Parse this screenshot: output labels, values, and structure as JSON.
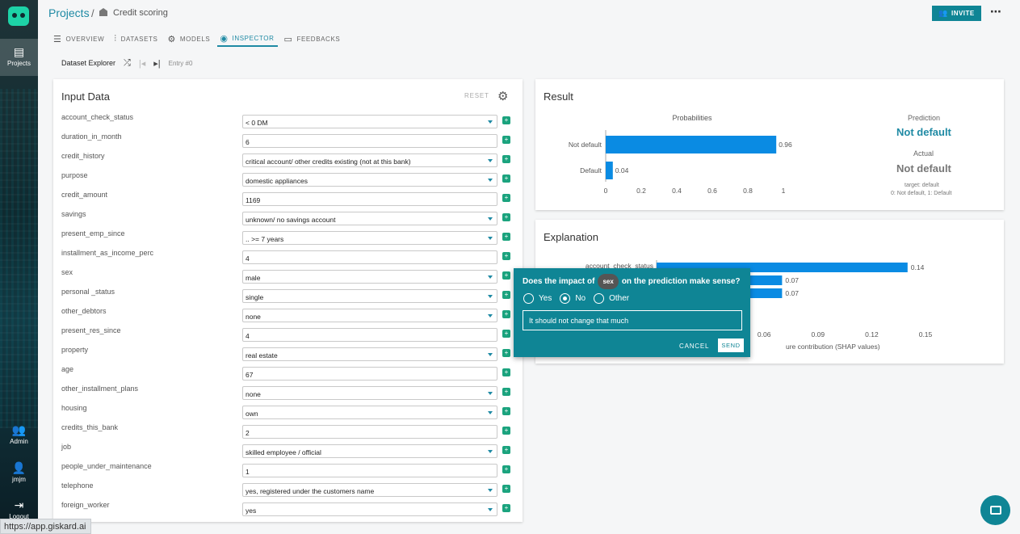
{
  "sidebar": {
    "projects_label": "Projects",
    "admin_label": "Admin",
    "user_label": "jmjm",
    "logout_label": "Logout"
  },
  "header": {
    "breadcrumb_root": "Projects",
    "breadcrumb_sep": "/",
    "breadcrumb_current": "Credit scoring",
    "invite_label": "INVITE",
    "more_label": "⋯"
  },
  "tabs": [
    {
      "label": "OVERVIEW",
      "icon": "list-icon",
      "active": false
    },
    {
      "label": "DATASETS",
      "icon": "bar-chart-icon",
      "active": false
    },
    {
      "label": "MODELS",
      "icon": "cog-icon",
      "active": false
    },
    {
      "label": "INSPECTOR",
      "icon": "inspector-icon",
      "active": true
    },
    {
      "label": "FEEDBACKS",
      "icon": "comment-icon",
      "active": false
    }
  ],
  "explorer": {
    "title": "Dataset Explorer",
    "entry_label": "Entry #0"
  },
  "input_data": {
    "title": "Input Data",
    "reset_label": "RESET",
    "fields": [
      {
        "label": "account_check_status",
        "value": "< 0 DM",
        "type": "select"
      },
      {
        "label": "duration_in_month",
        "value": "6",
        "type": "text"
      },
      {
        "label": "credit_history",
        "value": "critical account/ other credits existing (not at this bank)",
        "type": "select"
      },
      {
        "label": "purpose",
        "value": "domestic appliances",
        "type": "select"
      },
      {
        "label": "credit_amount",
        "value": "1169",
        "type": "text"
      },
      {
        "label": "savings",
        "value": "unknown/ no savings account",
        "type": "select"
      },
      {
        "label": "present_emp_since",
        "value": ".. >= 7 years",
        "type": "select"
      },
      {
        "label": "installment_as_income_perc",
        "value": "4",
        "type": "text"
      },
      {
        "label": "sex",
        "value": "male",
        "type": "select"
      },
      {
        "label": "personal _status",
        "value": "single",
        "type": "select"
      },
      {
        "label": "other_debtors",
        "value": "none",
        "type": "select"
      },
      {
        "label": "present_res_since",
        "value": "4",
        "type": "text"
      },
      {
        "label": "property",
        "value": "real estate",
        "type": "select"
      },
      {
        "label": "age",
        "value": "67",
        "type": "text"
      },
      {
        "label": "other_installment_plans",
        "value": "none",
        "type": "select"
      },
      {
        "label": "housing",
        "value": "own",
        "type": "select"
      },
      {
        "label": "credits_this_bank",
        "value": "2",
        "type": "text"
      },
      {
        "label": "job",
        "value": "skilled employee / official",
        "type": "select"
      },
      {
        "label": "people_under_maintenance",
        "value": "1",
        "type": "text"
      },
      {
        "label": "telephone",
        "value": "yes, registered under the customers name",
        "type": "select"
      },
      {
        "label": "foreign_worker",
        "value": "yes",
        "type": "select"
      }
    ]
  },
  "result": {
    "title": "Result",
    "probabilities_title": "Probabilities",
    "prediction_title": "Prediction",
    "prediction_value": "Not default",
    "actual_title": "Actual",
    "actual_value": "Not default",
    "target_note": "target: default",
    "target_map": "0: Not default, 1: Default"
  },
  "explanation": {
    "title": "Explanation",
    "xlabel": "ure contribution (SHAP values)",
    "partial_top_label": "account_check_status"
  },
  "feedback": {
    "question_prefix": "Does the impact of",
    "feature_chip": "sex",
    "question_suffix": "on the prediction make sense?",
    "options": [
      "Yes",
      "No",
      "Other"
    ],
    "selected": "No",
    "input_value": "It should not change that much",
    "cancel_label": "CANCEL",
    "send_label": "SEND"
  },
  "status_url": "https://app.giskard.ai",
  "colors": {
    "accent": "#0f8595",
    "bar": "#0a8be3",
    "feedback_icon": "#1ba37e"
  },
  "chart_data": [
    {
      "type": "bar",
      "orientation": "horizontal",
      "title": "Probabilities",
      "categories": [
        "Not default",
        "Default"
      ],
      "values": [
        0.96,
        0.04
      ],
      "value_labels": [
        "0.96",
        "0.04"
      ],
      "xlim": [
        0,
        1
      ],
      "xticks": [
        "0",
        "0.2",
        "0.4",
        "0.6",
        "0.8",
        "1"
      ]
    },
    {
      "type": "bar",
      "orientation": "horizontal",
      "title": "",
      "xlabel": "ure contribution (SHAP values)",
      "categories": [
        "account_check_status",
        "",
        ""
      ],
      "values": [
        0.14,
        0.07,
        0.07
      ],
      "value_labels": [
        "0.14",
        "0.07",
        "0.07"
      ],
      "xlim": [
        0,
        0.15
      ],
      "xticks_visible": [
        "0.06",
        "0.09",
        "0.12",
        "0.15"
      ]
    }
  ]
}
